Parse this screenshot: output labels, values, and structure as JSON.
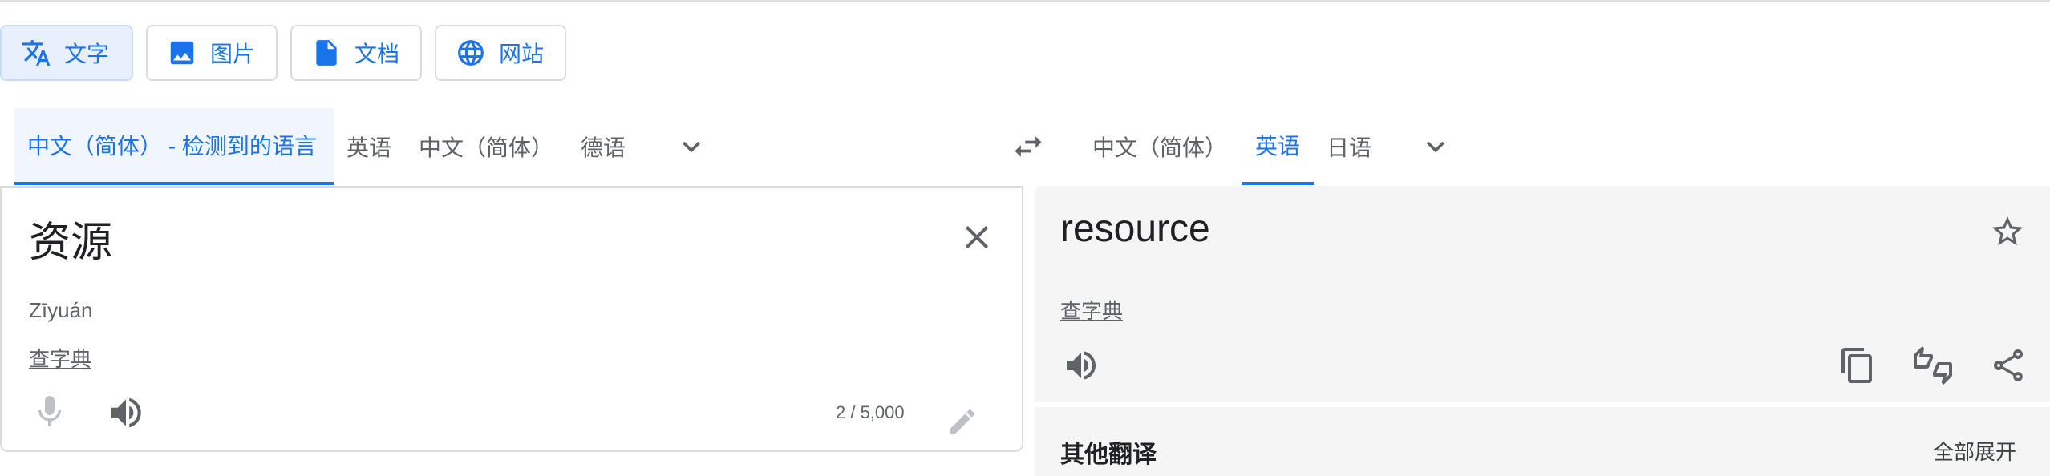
{
  "modes": [
    {
      "label": "文字",
      "icon": "translate-icon",
      "active": true
    },
    {
      "label": "图片",
      "icon": "image-icon",
      "active": false
    },
    {
      "label": "文档",
      "icon": "document-icon",
      "active": false
    },
    {
      "label": "网站",
      "icon": "globe-icon",
      "active": false
    }
  ],
  "source_languages": [
    {
      "label": "中文（简体） - 检测到的语言",
      "active": true
    },
    {
      "label": "英语",
      "active": false
    },
    {
      "label": "中文（简体）",
      "active": false
    },
    {
      "label": "德语",
      "active": false
    }
  ],
  "target_languages": [
    {
      "label": "中文（简体）",
      "active": false
    },
    {
      "label": "英语",
      "active": true
    },
    {
      "label": "日语",
      "active": false
    }
  ],
  "source": {
    "text": "资源",
    "pinyin": "Zīyuán",
    "dict_link": "查字典",
    "char_count": "2 / 5,000"
  },
  "target": {
    "text": "resource",
    "dict_link": "查字典"
  },
  "other_translations": {
    "title": "其他翻译",
    "expand_all": "全部展开"
  },
  "colors": {
    "accent": "#1a73e8",
    "panel_bg": "#f5f5f5",
    "border": "#dadce0"
  }
}
